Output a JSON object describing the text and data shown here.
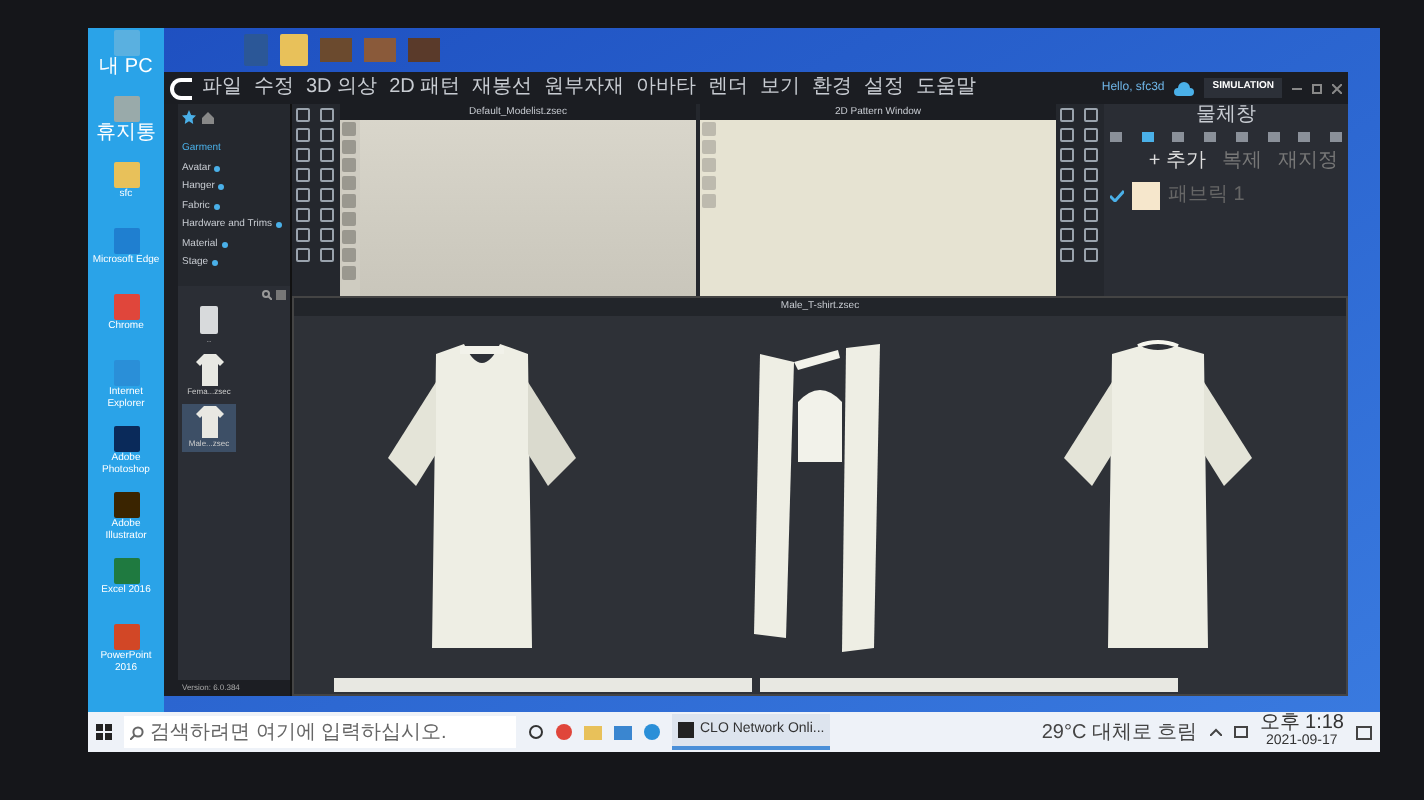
{
  "desktop_icons": [
    {
      "label": "내 PC"
    },
    {
      "label": "휴지통"
    },
    {
      "label": "sfc"
    },
    {
      "label": "Microsoft Edge"
    },
    {
      "label": "Chrome"
    },
    {
      "label": "Internet Explorer"
    },
    {
      "label": "Adobe Photoshop"
    },
    {
      "label": "Adobe Illustrator"
    },
    {
      "label": "Excel 2016"
    },
    {
      "label": "PowerPoint 2016"
    }
  ],
  "app": {
    "menu": [
      "파일",
      "수정",
      "3D 의상",
      "2D 패턴",
      "재봉선",
      "원부자재",
      "아바타",
      "렌더",
      "보기",
      "환경",
      "설정",
      "도움말"
    ],
    "user": "Hello, sfc3d",
    "mode": "SIMULATION",
    "library": {
      "tree": [
        {
          "label": "Garment",
          "selected": true
        },
        {
          "label": "Avatar",
          "selected": false
        },
        {
          "label": "Hanger",
          "selected": false
        },
        {
          "label": "Fabric",
          "selected": false
        },
        {
          "label": "Hardware and Trims",
          "selected": false
        },
        {
          "label": "Material",
          "selected": false
        },
        {
          "label": "Stage",
          "selected": false
        }
      ],
      "files": [
        {
          "label": "..",
          "kind": "folder",
          "selected": false
        },
        {
          "label": "Fema...zsec",
          "kind": "garment",
          "selected": false
        },
        {
          "label": "Male...zsec",
          "kind": "garment",
          "selected": true
        }
      ],
      "version": "Version: 6.0.384"
    },
    "windows": {
      "view_3d": "Default_Modelist.zsec",
      "view_2d": "2D Pattern Window",
      "preview": "Male_T-shirt.zsec"
    },
    "object_panel": {
      "title": "물체창",
      "actions": [
        "+ 추가",
        "복제",
        "재지정"
      ],
      "fabrics": [
        {
          "name": "패브릭 1",
          "color": "#f6e7cc",
          "checked": true
        }
      ]
    }
  },
  "taskbar": {
    "search_placeholder": "검색하려면 여기에 입력하십시오.",
    "apps": [
      {
        "label": "CLO Network Onli..."
      }
    ],
    "weather": "29°C 대체로 흐림",
    "time": "오후 1:18",
    "date": "2021-09-17"
  }
}
